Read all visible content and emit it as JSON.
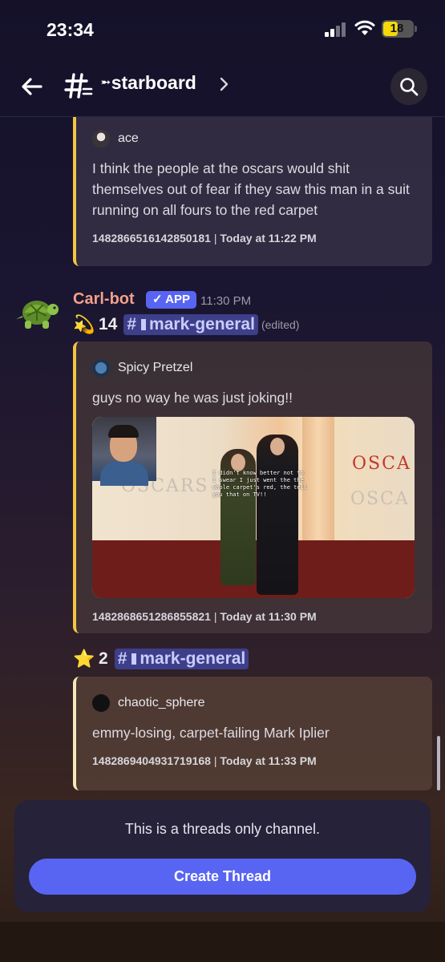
{
  "status_bar": {
    "time": "23:34",
    "battery": "18"
  },
  "header": {
    "channel_prefix": "➵",
    "channel_name": "starboard",
    "icons": {
      "back": "arrow-left-icon",
      "channel": "threads-channel-icon",
      "chevron": "chevron-right-icon",
      "search": "search-icon"
    }
  },
  "embed_top": {
    "author": "ace",
    "text": "I think the people at the oscars would shit themselves out of fear if they saw this man in a suit running on all fours to the red carpet",
    "message_id": "1482866516142850181",
    "separator": "|",
    "timestamp": "Today at 11:22 PM"
  },
  "message": {
    "author": "Carl-bot",
    "badge": "✓ APP",
    "time": "11:30 PM",
    "author_color": "#f2a08a"
  },
  "star_entry_1": {
    "emoji": "💫",
    "count": "14",
    "hash": "#",
    "channel": "mark-general",
    "edited": "(edited)",
    "embed": {
      "author": "Spicy Pretzel",
      "text": "guys no way he was just joking!!",
      "image_caption": "I didn't know better not to I swear I just went the the whole carpet's red, the tell you that on TV!!",
      "image_text_left": "OSCARS",
      "image_text_center": "OSCA",
      "image_text_right": "OSCA",
      "message_id": "1482868651286855821",
      "separator": "|",
      "timestamp": "Today at 11:30 PM"
    }
  },
  "star_entry_2": {
    "emoji": "⭐",
    "count": "2",
    "hash": "#",
    "channel": "mark-general",
    "embed": {
      "author": "chaotic_sphere",
      "text": "emmy-losing, carpet-failing Mark Iplier",
      "message_id": "1482869404931719168",
      "separator": "|",
      "timestamp": "Today at 11:33 PM"
    }
  },
  "bottom": {
    "notice": "This is a threads only channel.",
    "create_button": "Create Thread"
  },
  "colors": {
    "accent": "#5865f2",
    "embed_bar_gold": "#f4c542",
    "embed_bar_cream": "#f7e8b8",
    "mention_bg": "#3e3f8a"
  }
}
